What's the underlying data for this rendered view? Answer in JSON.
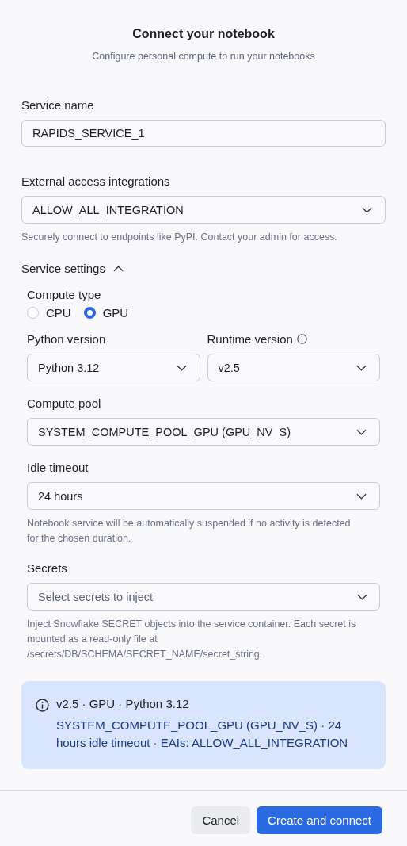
{
  "header": {
    "title": "Connect your notebook",
    "subtitle": "Configure personal compute to run your notebooks"
  },
  "service_name": {
    "label": "Service name",
    "value": "RAPIDS_SERVICE_1"
  },
  "external_access": {
    "label": "External access integrations",
    "value": "ALLOW_ALL_INTEGRATION",
    "hint": "Securely connect to endpoints like PyPI. Contact your admin for access."
  },
  "service_settings": {
    "label": "Service settings",
    "expanded": true,
    "compute_type": {
      "label": "Compute type",
      "options": [
        {
          "label": "CPU",
          "selected": false
        },
        {
          "label": "GPU",
          "selected": true
        }
      ]
    },
    "python_version": {
      "label": "Python version",
      "value": "Python 3.12"
    },
    "runtime_version": {
      "label": "Runtime version",
      "value": "v2.5"
    },
    "compute_pool": {
      "label": "Compute pool",
      "value": "SYSTEM_COMPUTE_POOL_GPU (GPU_NV_S)"
    },
    "idle_timeout": {
      "label": "Idle timeout",
      "value": "24 hours",
      "hint": "Notebook service will be automatically suspended if no activity is detected for the chosen duration."
    },
    "secrets": {
      "label": "Secrets",
      "placeholder": "Select secrets to inject",
      "hint": "Inject Snowflake SECRET objects into the service container. Each secret is mounted as a read-only file at /secrets/DB/SCHEMA/SECRET_NAME/secret_string."
    }
  },
  "summary": {
    "line_1": "v2.5 · GPU · Python 3.12",
    "line_2": "SYSTEM_COMPUTE_POOL_GPU (GPU_NV_S) · 24 hours idle timeout · EAIs: ALLOW_ALL_INTEGRATION"
  },
  "buttons": [
    {
      "label": "Cancel",
      "kind": "secondary"
    },
    {
      "label": "Create and connect",
      "kind": "primary"
    }
  ]
}
